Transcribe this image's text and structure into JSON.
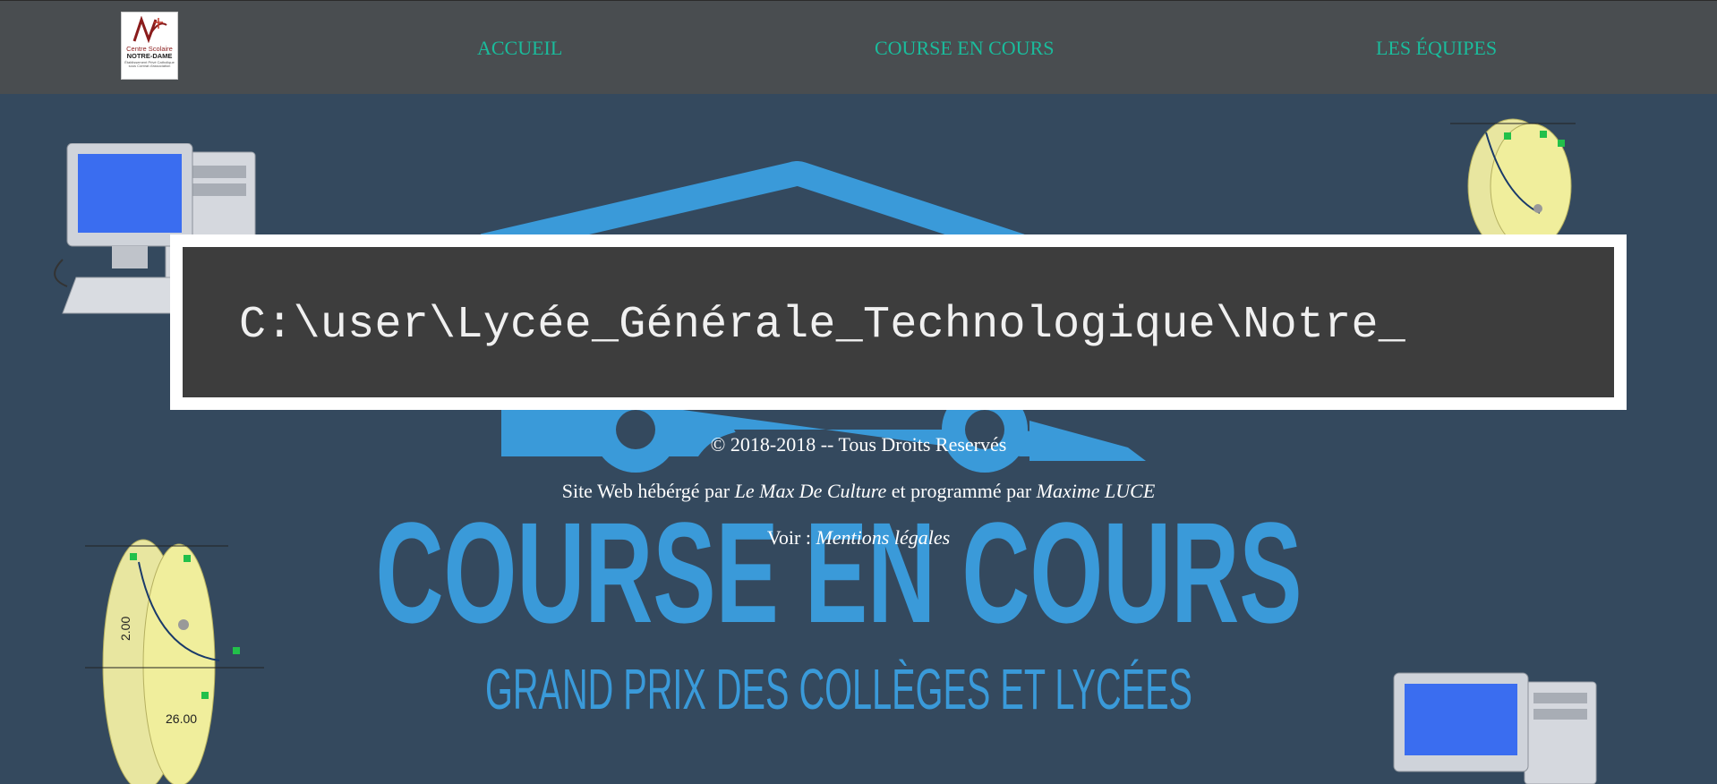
{
  "logo": {
    "line1": "Centre Scolaire",
    "line2": "NOTRE-DAME",
    "line3": "Établissement Privé Catholique sous Contrat d'association"
  },
  "nav": {
    "accueil": "ACCUEIL",
    "course": "COURSE EN COURS",
    "equipes": "LES ÉQUIPES"
  },
  "background": {
    "title": "COURSE EN COURS",
    "subtitle": "GRAND PRIX DES COLLÈGES ET LYCÉES"
  },
  "terminal": {
    "path": "C:\\user\\Lycée_Générale_Technologique\\Notre_"
  },
  "footer": {
    "copyright": "© 2018-2018 -- Tous Droits Reservés",
    "hosted_prefix": "Site Web hébérgé par ",
    "host_name": "Le Max De Culture",
    "programmed_mid": " et programmé par ",
    "author": "Maxime LUCE",
    "voir_prefix": "Voir : ",
    "legal_link": "Mentions légales"
  },
  "colors": {
    "background": "#34495e",
    "navbar": "#494d50",
    "nav_link": "#1abc9c",
    "logo_blue": "#3a9ad9"
  }
}
